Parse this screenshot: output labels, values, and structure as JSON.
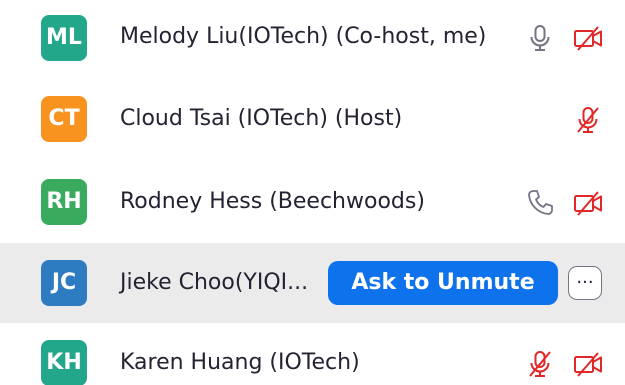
{
  "colors": {
    "avatar_teal": "#23a78b",
    "avatar_orange": "#f7931e",
    "avatar_green": "#3aaa5e",
    "avatar_blue": "#2d7cc1",
    "accent_blue": "#0e72ed",
    "muted_red": "#e02828",
    "icon_gray": "#747487",
    "row_hover": "#ebebeb"
  },
  "participants": [
    {
      "initials": "ML",
      "name": "Melody Liu(IOTech) (Co-host, me)",
      "audio": "mic-icon",
      "video": "video-off-icon"
    },
    {
      "initials": "CT",
      "name": "Cloud Tsai (IOTech) (Host)",
      "audio": "mic-muted-icon",
      "video": ""
    },
    {
      "initials": "RH",
      "name": "Rodney Hess (Beechwoods)",
      "audio": "phone-icon",
      "video": "video-off-icon"
    },
    {
      "initials": "JC",
      "name": "Jieke Choo(YIQI...",
      "audio": "",
      "video": ""
    },
    {
      "initials": "KH",
      "name": "Karen Huang (IOTech)",
      "audio": "mic-muted-icon",
      "video": "video-off-icon"
    }
  ],
  "actions": {
    "ask_to_unmute_label": "Ask to Unmute",
    "more_label": "···"
  }
}
